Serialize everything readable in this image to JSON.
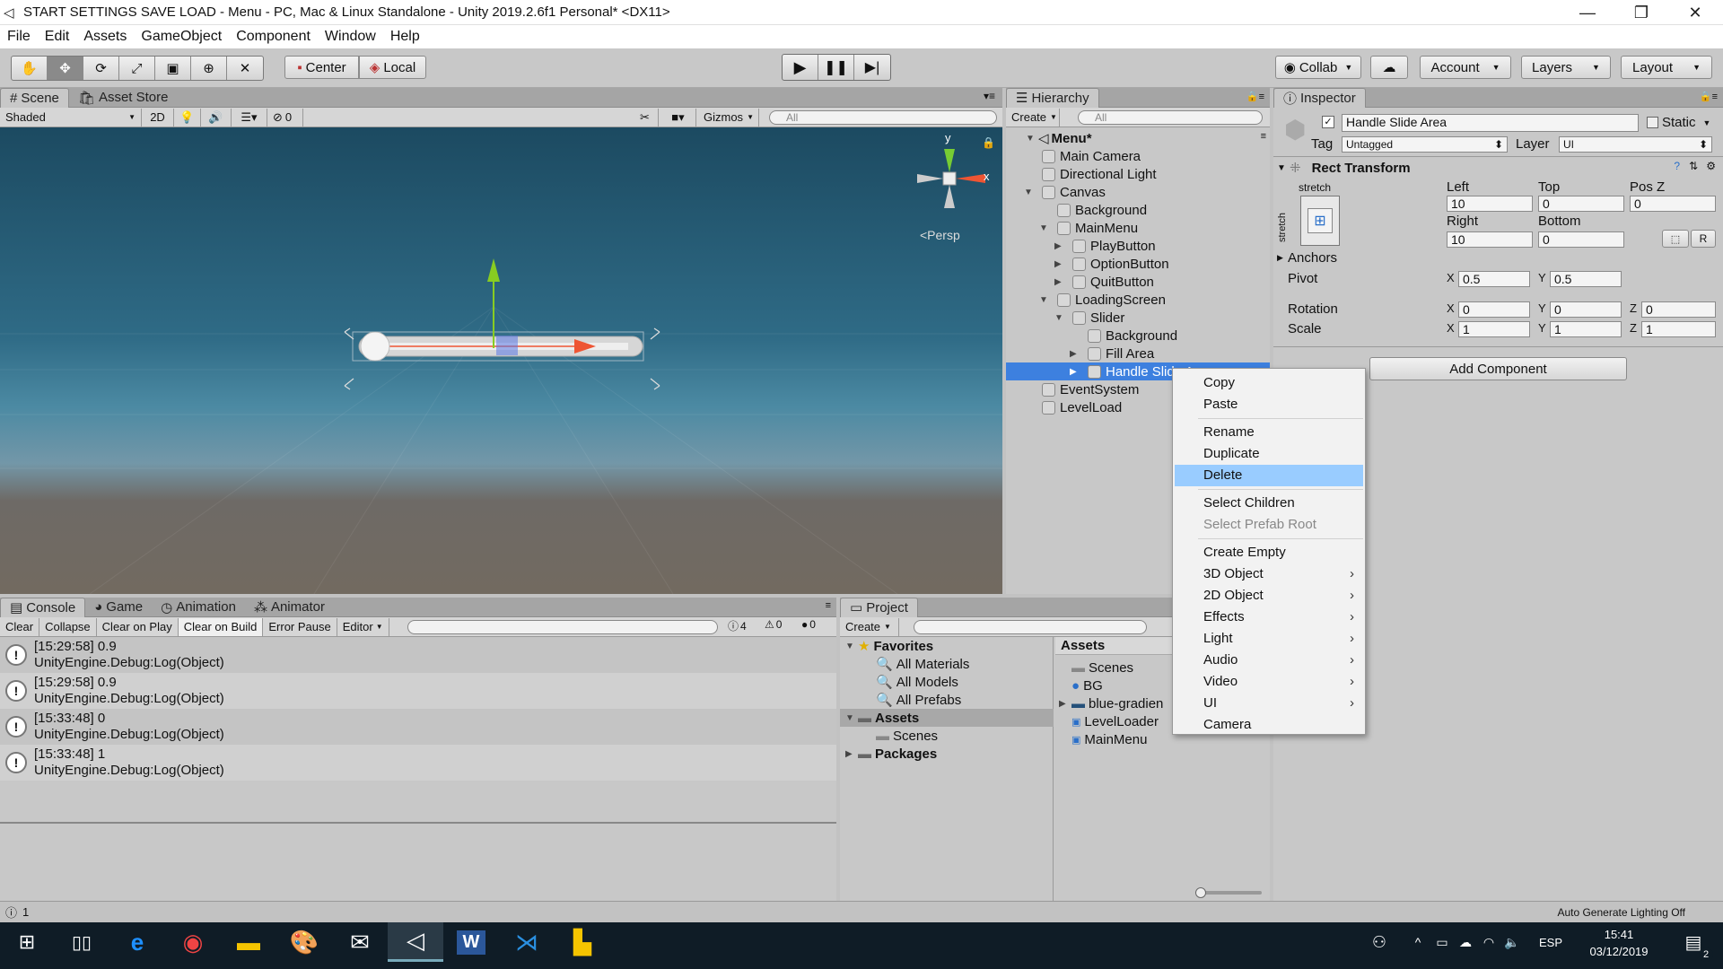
{
  "window": {
    "title": "START SETTINGS SAVE LOAD - Menu - PC, Mac & Linux Standalone - Unity 2019.2.6f1 Personal* <DX11>",
    "minimize": "—",
    "maximize": "❐",
    "close": "✕"
  },
  "menubar": [
    "File",
    "Edit",
    "Assets",
    "GameObject",
    "Component",
    "Window",
    "Help"
  ],
  "toolbar": {
    "pivot_label": "Center",
    "space_label": "Local",
    "collab_label": "Collab",
    "account_label": "Account",
    "layers_label": "Layers",
    "layout_label": "Layout"
  },
  "scene": {
    "tabs": [
      "Scene",
      "Asset Store"
    ],
    "shading": "Shaded",
    "mode_2d": "2D",
    "hidden_count": "0",
    "gizmos": "Gizmos",
    "search_placeholder": "All",
    "gizmo_y": "y",
    "gizmo_x": "x",
    "persp": "<Persp"
  },
  "hierarchy": {
    "tab": "Hierarchy",
    "create": "Create",
    "search_placeholder": "All",
    "scene_name": "Menu*",
    "items": [
      {
        "label": "Main Camera",
        "depth": 0,
        "arrow": ""
      },
      {
        "label": "Directional Light",
        "depth": 0,
        "arrow": ""
      },
      {
        "label": "Canvas",
        "depth": 0,
        "arrow": "▼"
      },
      {
        "label": "Background",
        "depth": 1,
        "arrow": ""
      },
      {
        "label": "MainMenu",
        "depth": 1,
        "arrow": "▼"
      },
      {
        "label": "PlayButton",
        "depth": 2,
        "arrow": "▶"
      },
      {
        "label": "OptionButton",
        "depth": 2,
        "arrow": "▶"
      },
      {
        "label": "QuitButton",
        "depth": 2,
        "arrow": "▶"
      },
      {
        "label": "LoadingScreen",
        "depth": 1,
        "arrow": "▼"
      },
      {
        "label": "Slider",
        "depth": 2,
        "arrow": "▼"
      },
      {
        "label": "Background",
        "depth": 3,
        "arrow": ""
      },
      {
        "label": "Fill Area",
        "depth": 3,
        "arrow": "▶"
      },
      {
        "label": "Handle Slide Area",
        "depth": 3,
        "arrow": "▶",
        "selected": true
      },
      {
        "label": "EventSystem",
        "depth": 0,
        "arrow": ""
      },
      {
        "label": "LevelLoad",
        "depth": 0,
        "arrow": ""
      }
    ]
  },
  "context_menu": {
    "items": [
      {
        "label": "Copy"
      },
      {
        "label": "Paste"
      },
      {
        "sep": true
      },
      {
        "label": "Rename"
      },
      {
        "label": "Duplicate"
      },
      {
        "label": "Delete",
        "selected": true
      },
      {
        "sep": true
      },
      {
        "label": "Select Children"
      },
      {
        "label": "Select Prefab Root",
        "disabled": true
      },
      {
        "sep": true
      },
      {
        "label": "Create Empty"
      },
      {
        "label": "3D Object",
        "sub": true
      },
      {
        "label": "2D Object",
        "sub": true
      },
      {
        "label": "Effects",
        "sub": true
      },
      {
        "label": "Light",
        "sub": true
      },
      {
        "label": "Audio",
        "sub": true
      },
      {
        "label": "Video",
        "sub": true
      },
      {
        "label": "UI",
        "sub": true
      },
      {
        "label": "Camera"
      }
    ]
  },
  "inspector": {
    "tab": "Inspector",
    "object_name": "Handle Slide Area",
    "static_label": "Static",
    "tag_label": "Tag",
    "tag_value": "Untagged",
    "layer_label": "Layer",
    "layer_value": "UI",
    "component": "Rect Transform",
    "stretch_h": "stretch",
    "stretch_v": "stretch",
    "left_label": "Left",
    "left": "10",
    "top_label": "Top",
    "top": "0",
    "posz_label": "Pos Z",
    "posz": "0",
    "right_label": "Right",
    "right": "10",
    "bottom_label": "Bottom",
    "bottom": "0",
    "r_button": "R",
    "anchors_label": "Anchors",
    "pivot_label": "Pivot",
    "pivot_x": "0.5",
    "pivot_y": "0.5",
    "rotation_label": "Rotation",
    "rot_x": "0",
    "rot_y": "0",
    "rot_z": "0",
    "scale_label": "Scale",
    "scale_x": "1",
    "scale_y": "1",
    "scale_z": "1",
    "x": "X",
    "y": "Y",
    "z": "Z",
    "add_component": "Add Component"
  },
  "console": {
    "tabs": [
      "Console",
      "Game",
      "Animation",
      "Animator"
    ],
    "buttons": [
      "Clear",
      "Collapse",
      "Clear on Play",
      "Clear on Build",
      "Error Pause",
      "Editor"
    ],
    "info_count": "4",
    "warn_count": "0",
    "error_count": "0",
    "logs": [
      {
        "time": "[15:29:58] 0.9",
        "detail": "UnityEngine.Debug:Log(Object)"
      },
      {
        "time": "[15:29:58] 0.9",
        "detail": "UnityEngine.Debug:Log(Object)"
      },
      {
        "time": "[15:33:48] 0",
        "detail": "UnityEngine.Debug:Log(Object)"
      },
      {
        "time": "[15:33:48] 1",
        "detail": "UnityEngine.Debug:Log(Object)"
      }
    ]
  },
  "project": {
    "tab": "Project",
    "create": "Create",
    "favorites": "Favorites",
    "fav_items": [
      "All Materials",
      "All Models",
      "All Prefabs"
    ],
    "assets": "Assets",
    "scenes": "Scenes",
    "packages": "Packages",
    "assets_header": "Assets",
    "asset_items": [
      "Scenes",
      "BG",
      "blue-gradien",
      "LevelLoader",
      "MainMenu"
    ]
  },
  "statusbar": {
    "count": "1",
    "lighting": "Auto Generate Lighting Off"
  },
  "taskbar": {
    "lang": "ESP",
    "time": "15:41",
    "date": "03/12/2019",
    "notif": "2"
  }
}
